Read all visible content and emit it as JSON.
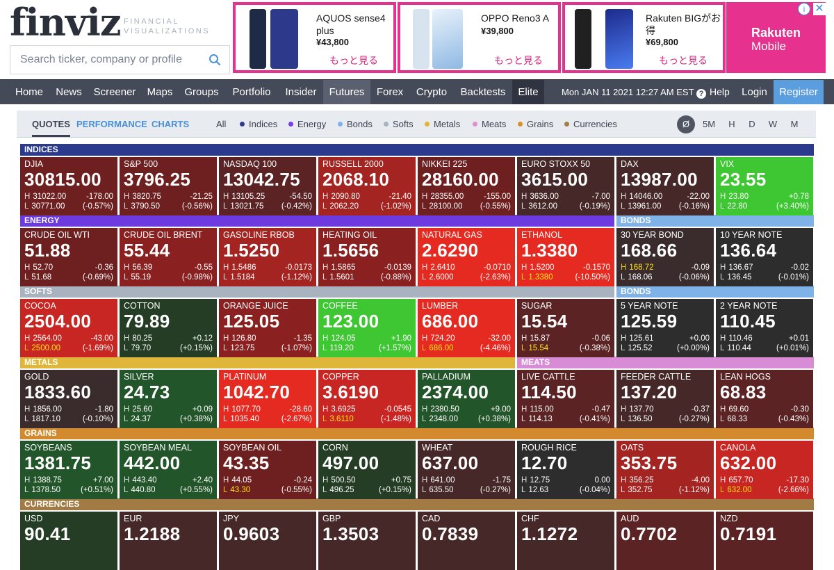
{
  "header": {
    "logo": "finviz",
    "tagline": "FINANCIAL VISUALIZATIONS",
    "search_placeholder": "Search ticker, company or profile"
  },
  "ads": [
    {
      "name": "AQUOS sense4 plus",
      "price": "¥43,800",
      "more": "もっと見る",
      "phone_colors": [
        "#1f2a44",
        "#2d3a8c"
      ]
    },
    {
      "name": "OPPO Reno3 A",
      "price": "¥39,800",
      "more": "もっと見る",
      "phone_colors": [
        "#d7e3ee",
        "#9fc8e8"
      ]
    },
    {
      "name": "Rakuten BIGがお得",
      "price": "¥69,800",
      "more": "もっと見る",
      "phone_colors": [
        "#202020",
        "#3a5fd8"
      ]
    }
  ],
  "rakuten": {
    "line1": "Rakuten",
    "line2": "Mobile"
  },
  "nav": {
    "items": [
      "Home",
      "News",
      "Screener",
      "Maps",
      "Groups",
      "Portfolio",
      "Insider",
      "Futures",
      "Forex",
      "Crypto",
      "Backtests",
      "Elite"
    ],
    "active": "Futures",
    "date": "Mon JAN 11 2021 12:27 AM EST",
    "help": "Help",
    "login": "Login",
    "register": "Register"
  },
  "subnav": {
    "tabs": [
      "QUOTES",
      "PERFORMANCE",
      "CHARTS"
    ],
    "filters": [
      {
        "label": "All",
        "color": ""
      },
      {
        "label": "Indices",
        "color": "#2f3b8f"
      },
      {
        "label": "Energy",
        "color": "#7c3aed"
      },
      {
        "label": "Bonds",
        "color": "#7fb3e8"
      },
      {
        "label": "Softs",
        "color": "#a7b3c2"
      },
      {
        "label": "Metals",
        "color": "#e3b532"
      },
      {
        "label": "Meats",
        "color": "#e18fd0"
      },
      {
        "label": "Grains",
        "color": "#d9902a"
      },
      {
        "label": "Currencies",
        "color": "#a47c45"
      }
    ],
    "timeframes": [
      "Ø",
      "5M",
      "H",
      "D",
      "W",
      "M"
    ],
    "timeframe_selected": "Ø"
  },
  "bands": {
    "indices": {
      "label": "INDICES",
      "color": "#2b3a8c"
    },
    "energy": {
      "label": "ENERGY",
      "color": "#6d3ae0"
    },
    "bonds": {
      "label": "BONDS",
      "color": "#7fb3e8"
    },
    "softs": {
      "label": "SOFTS",
      "color": "#a9b3c0"
    },
    "metals": {
      "label": "METALS",
      "color": "#e0b63a"
    },
    "meats": {
      "label": "MEATS",
      "color": "#d98cd6"
    },
    "grains": {
      "label": "GRAINS",
      "color": "#d38a2e"
    },
    "currencies": {
      "label": "CURRENCIES",
      "color": "#a17a44"
    }
  },
  "rows": [
    [
      {
        "name": "DJIA",
        "price": "30815.00",
        "high": "31022.00",
        "low": "30771.00",
        "change": "-178.00",
        "pct": "(-0.57%)",
        "bg": "#6e1f1f"
      },
      {
        "name": "S&P 500",
        "price": "3796.25",
        "high": "3820.75",
        "low": "3790.50",
        "change": "-21.25",
        "pct": "(-0.56%)",
        "bg": "#6e1f1f"
      },
      {
        "name": "NASDAQ 100",
        "price": "13042.75",
        "high": "13105.25",
        "low": "13021.75",
        "change": "-54.50",
        "pct": "(-0.42%)",
        "bg": "#5b2323"
      },
      {
        "name": "RUSSELL 2000",
        "price": "2068.10",
        "high": "2090.80",
        "low": "2062.20",
        "change": "-21.40",
        "pct": "(-1.02%)",
        "bg": "#a42422"
      },
      {
        "name": "NIKKEI 225",
        "price": "28160.00",
        "high": "28355.00",
        "low": "28100.00",
        "change": "-155.00",
        "pct": "(-0.55%)",
        "bg": "#6e1f1f"
      },
      {
        "name": "EURO STOXX 50",
        "price": "3615.00",
        "high": "3636.00",
        "low": "3612.00",
        "change": "-7.00",
        "pct": "(-0.19%)",
        "bg": "#472828"
      },
      {
        "name": "DAX",
        "price": "13987.00",
        "high": "14046.00",
        "low": "13961.00",
        "change": "-22.00",
        "pct": "(-0.16%)",
        "bg": "#472828"
      },
      {
        "name": "VIX",
        "price": "23.55",
        "high": "23.80",
        "low": "22.80",
        "change": "+0.78",
        "pct": "(+3.40%)",
        "bg": "#3fc733"
      }
    ],
    [
      {
        "name": "CRUDE OIL WTI",
        "price": "51.88",
        "high": "52.70",
        "low": "51.68",
        "change": "-0.36",
        "pct": "(-0.69%)",
        "bg": "#6e1f1f"
      },
      {
        "name": "CRUDE OIL BRENT",
        "price": "55.44",
        "high": "56.39",
        "low": "55.19",
        "change": "-0.55",
        "pct": "(-0.98%)",
        "bg": "#8a2020"
      },
      {
        "name": "GASOLINE RBOB",
        "price": "1.5250",
        "high": "1.5486",
        "low": "1.5184",
        "change": "-0.0173",
        "pct": "(-1.12%)",
        "bg": "#a42422"
      },
      {
        "name": "HEATING OIL",
        "price": "1.5656",
        "high": "1.5865",
        "low": "1.5601",
        "change": "-0.0139",
        "pct": "(-0.88%)",
        "bg": "#8a2020"
      },
      {
        "name": "NATURAL GAS",
        "price": "2.6290",
        "high": "2.6410",
        "low": "2.6000",
        "change": "-0.0710",
        "pct": "(-2.63%)",
        "bg": "#e52b21"
      },
      {
        "name": "ETHANOL",
        "price": "1.3380",
        "high": "1.5200",
        "low": "1.3380",
        "change": "-0.1570",
        "pct": "(-10.50%)",
        "bg": "#e52b21",
        "low_hl": true
      },
      {
        "name": "30 YEAR BOND",
        "price": "168.66",
        "high": "168.72",
        "low": "168.06",
        "change": "-0.09",
        "pct": "(-0.06%)",
        "bg": "#3a2c2c",
        "high_hl": true
      },
      {
        "name": "10 YEAR NOTE",
        "price": "136.64",
        "high": "136.67",
        "low": "136.45",
        "change": "-0.02",
        "pct": "(-0.01%)",
        "bg": "#2d2d2d"
      }
    ],
    [
      {
        "name": "COCOA",
        "price": "2504.00",
        "high": "2564.00",
        "low": "2500.00",
        "change": "-43.00",
        "pct": "(-1.69%)",
        "bg": "#c82622",
        "low_hl": true
      },
      {
        "name": "COTTON",
        "price": "79.89",
        "high": "80.25",
        "low": "79.70",
        "change": "+0.12",
        "pct": "(+0.15%)",
        "bg": "#243d24"
      },
      {
        "name": "ORANGE JUICE",
        "price": "125.05",
        "high": "126.80",
        "low": "123.75",
        "change": "-1.35",
        "pct": "(-1.07%)",
        "bg": "#8a2020"
      },
      {
        "name": "COFFEE",
        "price": "123.00",
        "high": "124.05",
        "low": "119.20",
        "change": "+1.90",
        "pct": "(+1.57%)",
        "bg": "#3fc733"
      },
      {
        "name": "LUMBER",
        "price": "686.00",
        "high": "724.20",
        "low": "686.00",
        "change": "-32.00",
        "pct": "(-4.46%)",
        "bg": "#e52b21",
        "low_hl": true
      },
      {
        "name": "SUGAR",
        "price": "15.54",
        "high": "15.87",
        "low": "15.54",
        "change": "-0.06",
        "pct": "(-0.38%)",
        "bg": "#5b2323",
        "low_hl": true
      },
      {
        "name": "5 YEAR NOTE",
        "price": "125.59",
        "high": "125.61",
        "low": "125.52",
        "change": "+0.00",
        "pct": "(+0.00%)",
        "bg": "#2d2d2d"
      },
      {
        "name": "2 YEAR NOTE",
        "price": "110.45",
        "high": "110.46",
        "low": "110.44",
        "change": "+0.01",
        "pct": "(+0.01%)",
        "bg": "#2d2d2d"
      }
    ],
    [
      {
        "name": "GOLD",
        "price": "1833.60",
        "high": "1856.00",
        "low": "1817.10",
        "change": "-1.80",
        "pct": "(-0.10%)",
        "bg": "#3a2c2c"
      },
      {
        "name": "SILVER",
        "price": "24.73",
        "high": "25.60",
        "low": "24.37",
        "change": "+0.09",
        "pct": "(+0.38%)",
        "bg": "#23552a"
      },
      {
        "name": "PLATINUM",
        "price": "1042.70",
        "high": "1077.70",
        "low": "1035.40",
        "change": "-28.60",
        "pct": "(-2.67%)",
        "bg": "#e52b21"
      },
      {
        "name": "COPPER",
        "price": "3.6190",
        "high": "3.6925",
        "low": "3.6110",
        "change": "-0.0545",
        "pct": "(-1.48%)",
        "bg": "#c82622",
        "low_hl": true
      },
      {
        "name": "PALLADIUM",
        "price": "2374.00",
        "high": "2380.50",
        "low": "2348.00",
        "change": "+9.00",
        "pct": "(+0.38%)",
        "bg": "#23552a"
      },
      {
        "name": "LIVE CATTLE",
        "price": "114.50",
        "high": "115.00",
        "low": "114.13",
        "change": "-0.47",
        "pct": "(-0.41%)",
        "bg": "#5b2323"
      },
      {
        "name": "FEEDER CATTLE",
        "price": "137.20",
        "high": "137.70",
        "low": "136.50",
        "change": "-0.37",
        "pct": "(-0.27%)",
        "bg": "#472828"
      },
      {
        "name": "LEAN HOGS",
        "price": "68.83",
        "high": "69.60",
        "low": "68.33",
        "change": "-0.30",
        "pct": "(-0.43%)",
        "bg": "#5b2323"
      }
    ],
    [
      {
        "name": "SOYBEANS",
        "price": "1381.75",
        "high": "1388.75",
        "low": "1378.50",
        "change": "+7.00",
        "pct": "(+0.51%)",
        "bg": "#23552a"
      },
      {
        "name": "SOYBEAN MEAL",
        "price": "442.00",
        "high": "443.40",
        "low": "440.80",
        "change": "+2.40",
        "pct": "(+0.55%)",
        "bg": "#23552a"
      },
      {
        "name": "SOYBEAN OIL",
        "price": "43.35",
        "high": "44.05",
        "low": "43.30",
        "change": "-0.24",
        "pct": "(-0.55%)",
        "bg": "#6e1f1f",
        "low_hl": true
      },
      {
        "name": "CORN",
        "price": "497.00",
        "high": "500.50",
        "low": "496.25",
        "change": "+0.75",
        "pct": "(+0.15%)",
        "bg": "#243d24"
      },
      {
        "name": "WHEAT",
        "price": "637.00",
        "high": "641.00",
        "low": "635.50",
        "change": "-1.75",
        "pct": "(-0.27%)",
        "bg": "#472828"
      },
      {
        "name": "ROUGH RICE",
        "price": "12.70",
        "high": "12.75",
        "low": "12.63",
        "change": "0.00",
        "pct": "(-0.04%)",
        "bg": "#2d2d2d"
      },
      {
        "name": "OATS",
        "price": "353.75",
        "high": "356.25",
        "low": "352.75",
        "change": "-4.00",
        "pct": "(-1.12%)",
        "bg": "#a42422"
      },
      {
        "name": "CANOLA",
        "price": "632.00",
        "high": "657.70",
        "low": "632.00",
        "change": "-17.30",
        "pct": "(-2.66%)",
        "bg": "#c82622",
        "low_hl": true
      }
    ],
    [
      {
        "name": "USD",
        "price": "90.41",
        "bg": "#243d24"
      },
      {
        "name": "EUR",
        "price": "1.2188",
        "bg": "#472828"
      },
      {
        "name": "JPY",
        "price": "0.9603",
        "bg": "#472828"
      },
      {
        "name": "GBP",
        "price": "1.3503",
        "bg": "#472828"
      },
      {
        "name": "CAD",
        "price": "0.7839",
        "bg": "#472828"
      },
      {
        "name": "CHF",
        "price": "1.1272",
        "bg": "#472828"
      },
      {
        "name": "AUD",
        "price": "0.7702",
        "bg": "#5b2323"
      },
      {
        "name": "NZD",
        "price": "0.7191",
        "bg": "#5b2323"
      }
    ]
  ]
}
